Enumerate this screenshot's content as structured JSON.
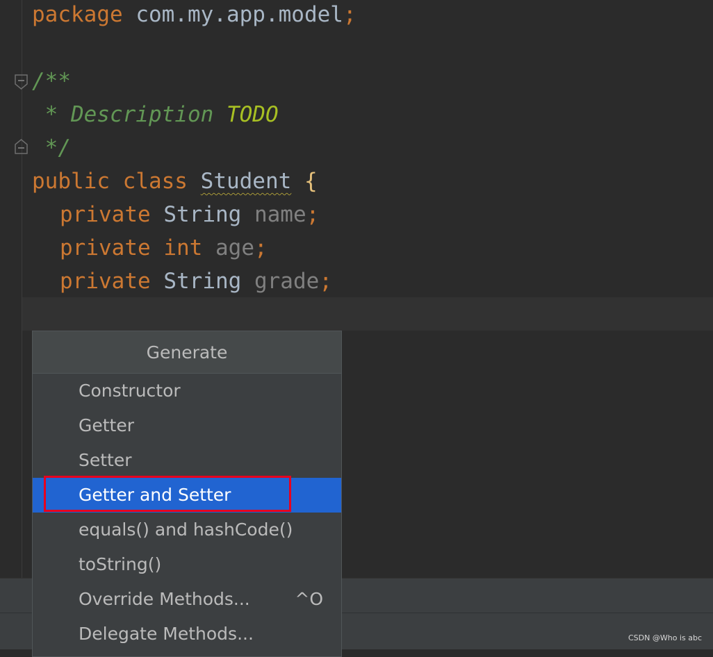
{
  "code": {
    "line1": {
      "kw": "package",
      "rest": " com.my.app.model",
      "semi": ";"
    },
    "line3": {
      "text": "/**"
    },
    "line4": {
      "star": " * Description ",
      "todo": "TODO"
    },
    "line5": {
      "text": " */"
    },
    "line6": {
      "kw1": "public",
      "kw2": "class",
      "name": "Student",
      "brace": "{"
    },
    "fields": [
      {
        "kw": "private",
        "type": "String",
        "name": "name",
        "semi": ";"
      },
      {
        "kw": "private",
        "type": "int",
        "name": "age",
        "semi": ";"
      },
      {
        "kw": "private",
        "type": "String",
        "name": "grade",
        "semi": ";"
      }
    ]
  },
  "popup": {
    "title": "Generate",
    "items": [
      {
        "label": "Constructor"
      },
      {
        "label": "Getter"
      },
      {
        "label": "Setter"
      },
      {
        "label": "Getter and Setter"
      },
      {
        "label": "equals() and hashCode()"
      },
      {
        "label": "toString()"
      },
      {
        "label": "Override Methods...",
        "shortcut": "^O"
      },
      {
        "label": "Delegate Methods..."
      }
    ],
    "selected_index": 3
  },
  "watermark": "CSDN @Who is abc",
  "colors": {
    "background": "#2b2b2b",
    "keyword": "#cc7832",
    "comment": "#629755",
    "todo": "#a8c023",
    "selection": "#2164d1",
    "highlight_box": "#e8001e"
  }
}
